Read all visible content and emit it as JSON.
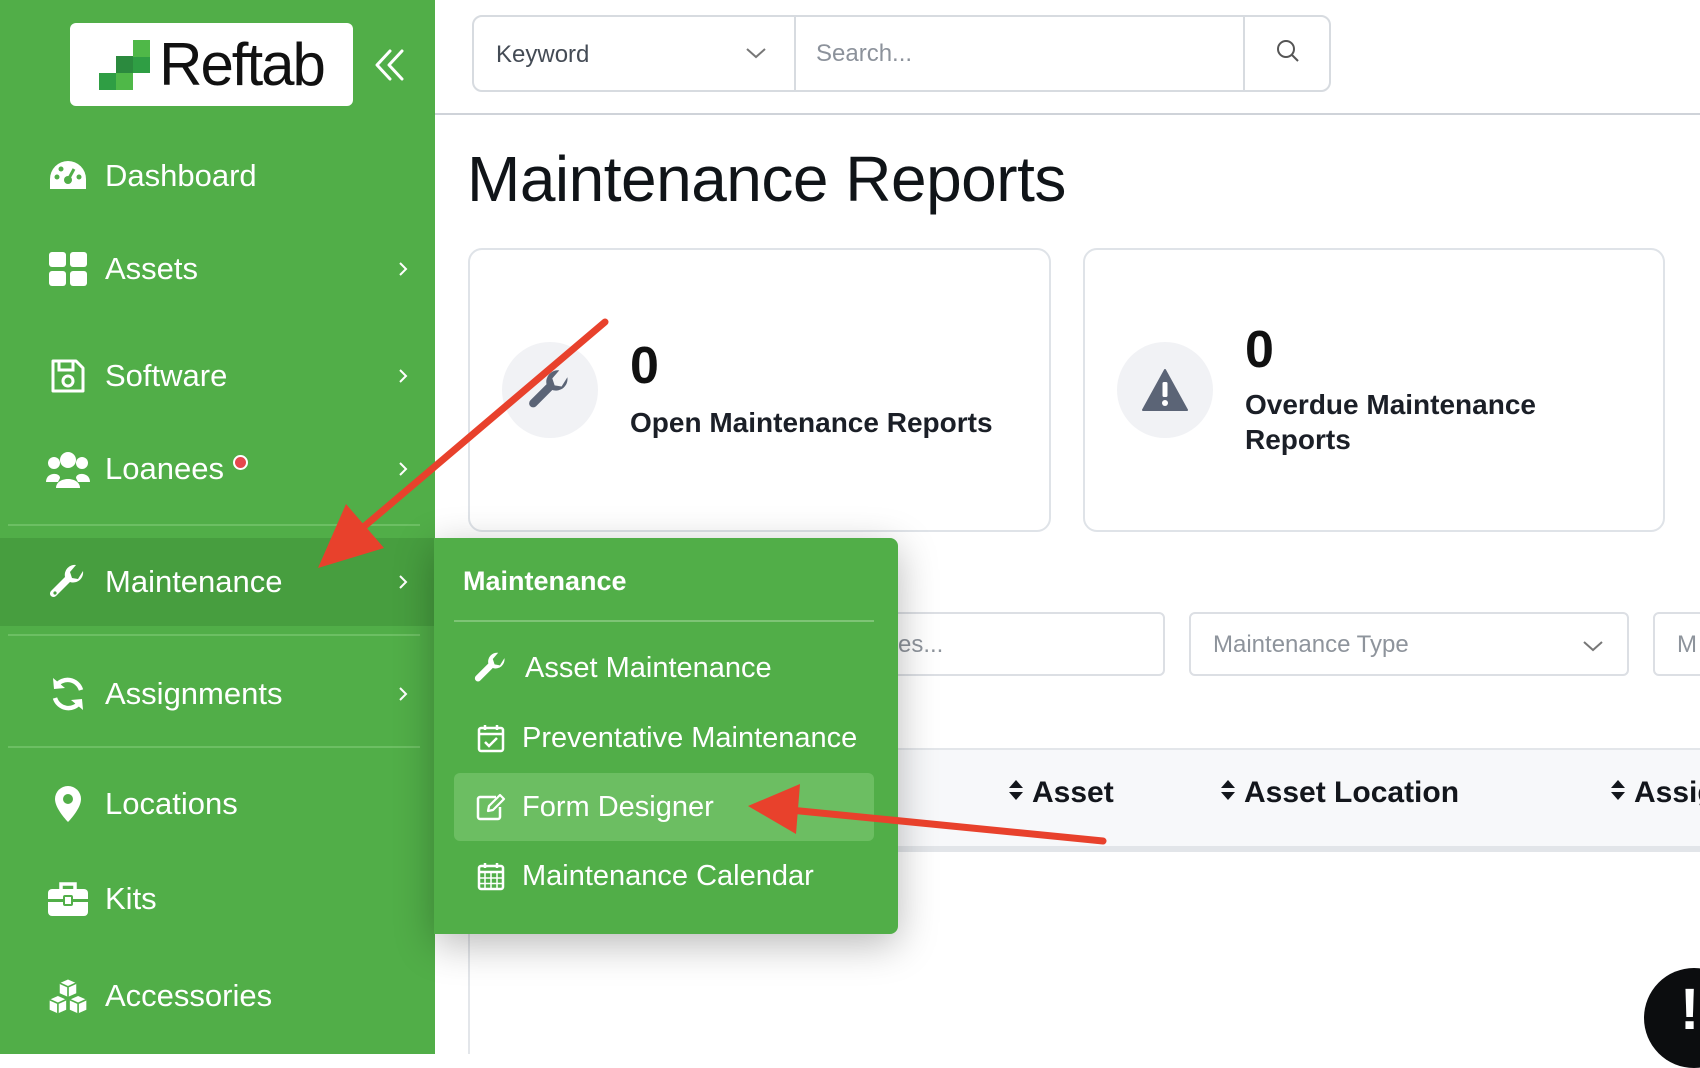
{
  "brand": {
    "name": "Reftab",
    "green": "#51ae48",
    "active_green": "#479e3f"
  },
  "sidebar": {
    "items": [
      {
        "label": "Dashboard",
        "icon": "dashboard-gauge-icon"
      },
      {
        "label": "Assets",
        "icon": "grid-icon"
      },
      {
        "label": "Software",
        "icon": "floppy-disk-icon"
      },
      {
        "label": "Loanees",
        "icon": "users-icon"
      },
      {
        "label": "Maintenance",
        "icon": "wrench-icon",
        "active": true
      },
      {
        "label": "Assignments",
        "icon": "sync-icon"
      },
      {
        "label": "Locations",
        "icon": "map-pin-icon"
      },
      {
        "label": "Kits",
        "icon": "toolbox-icon"
      },
      {
        "label": "Accessories",
        "icon": "cubes-icon"
      }
    ]
  },
  "search": {
    "type_value": "Keyword",
    "placeholder": "Search..."
  },
  "page": {
    "title": "Maintenance Reports"
  },
  "stats": [
    {
      "value": "0",
      "label": "Open Maintenance Reports",
      "icon": "wrench-icon"
    },
    {
      "value": "0",
      "label": "Overdue Maintenance Reports",
      "icon": "warning-triangle-icon"
    }
  ],
  "filters": {
    "search_partial": "es...",
    "maintenance_type": "Maintenance Type",
    "third_partial": "M"
  },
  "table": {
    "columns": [
      "Asset",
      "Asset Location",
      "Assig"
    ]
  },
  "dropdown": {
    "title": "Maintenance",
    "items": [
      {
        "label": "Asset Maintenance",
        "icon": "wrench-icon"
      },
      {
        "label": "Preventative Maintenance",
        "icon": "calendar-check-icon"
      },
      {
        "label": "Form Designer",
        "icon": "edit-form-icon",
        "highlighted": true
      },
      {
        "label": "Maintenance Calendar",
        "icon": "calendar-grid-icon"
      }
    ]
  },
  "alert_fab": {
    "symbol": "!"
  },
  "annotation_color": "#e8412c"
}
